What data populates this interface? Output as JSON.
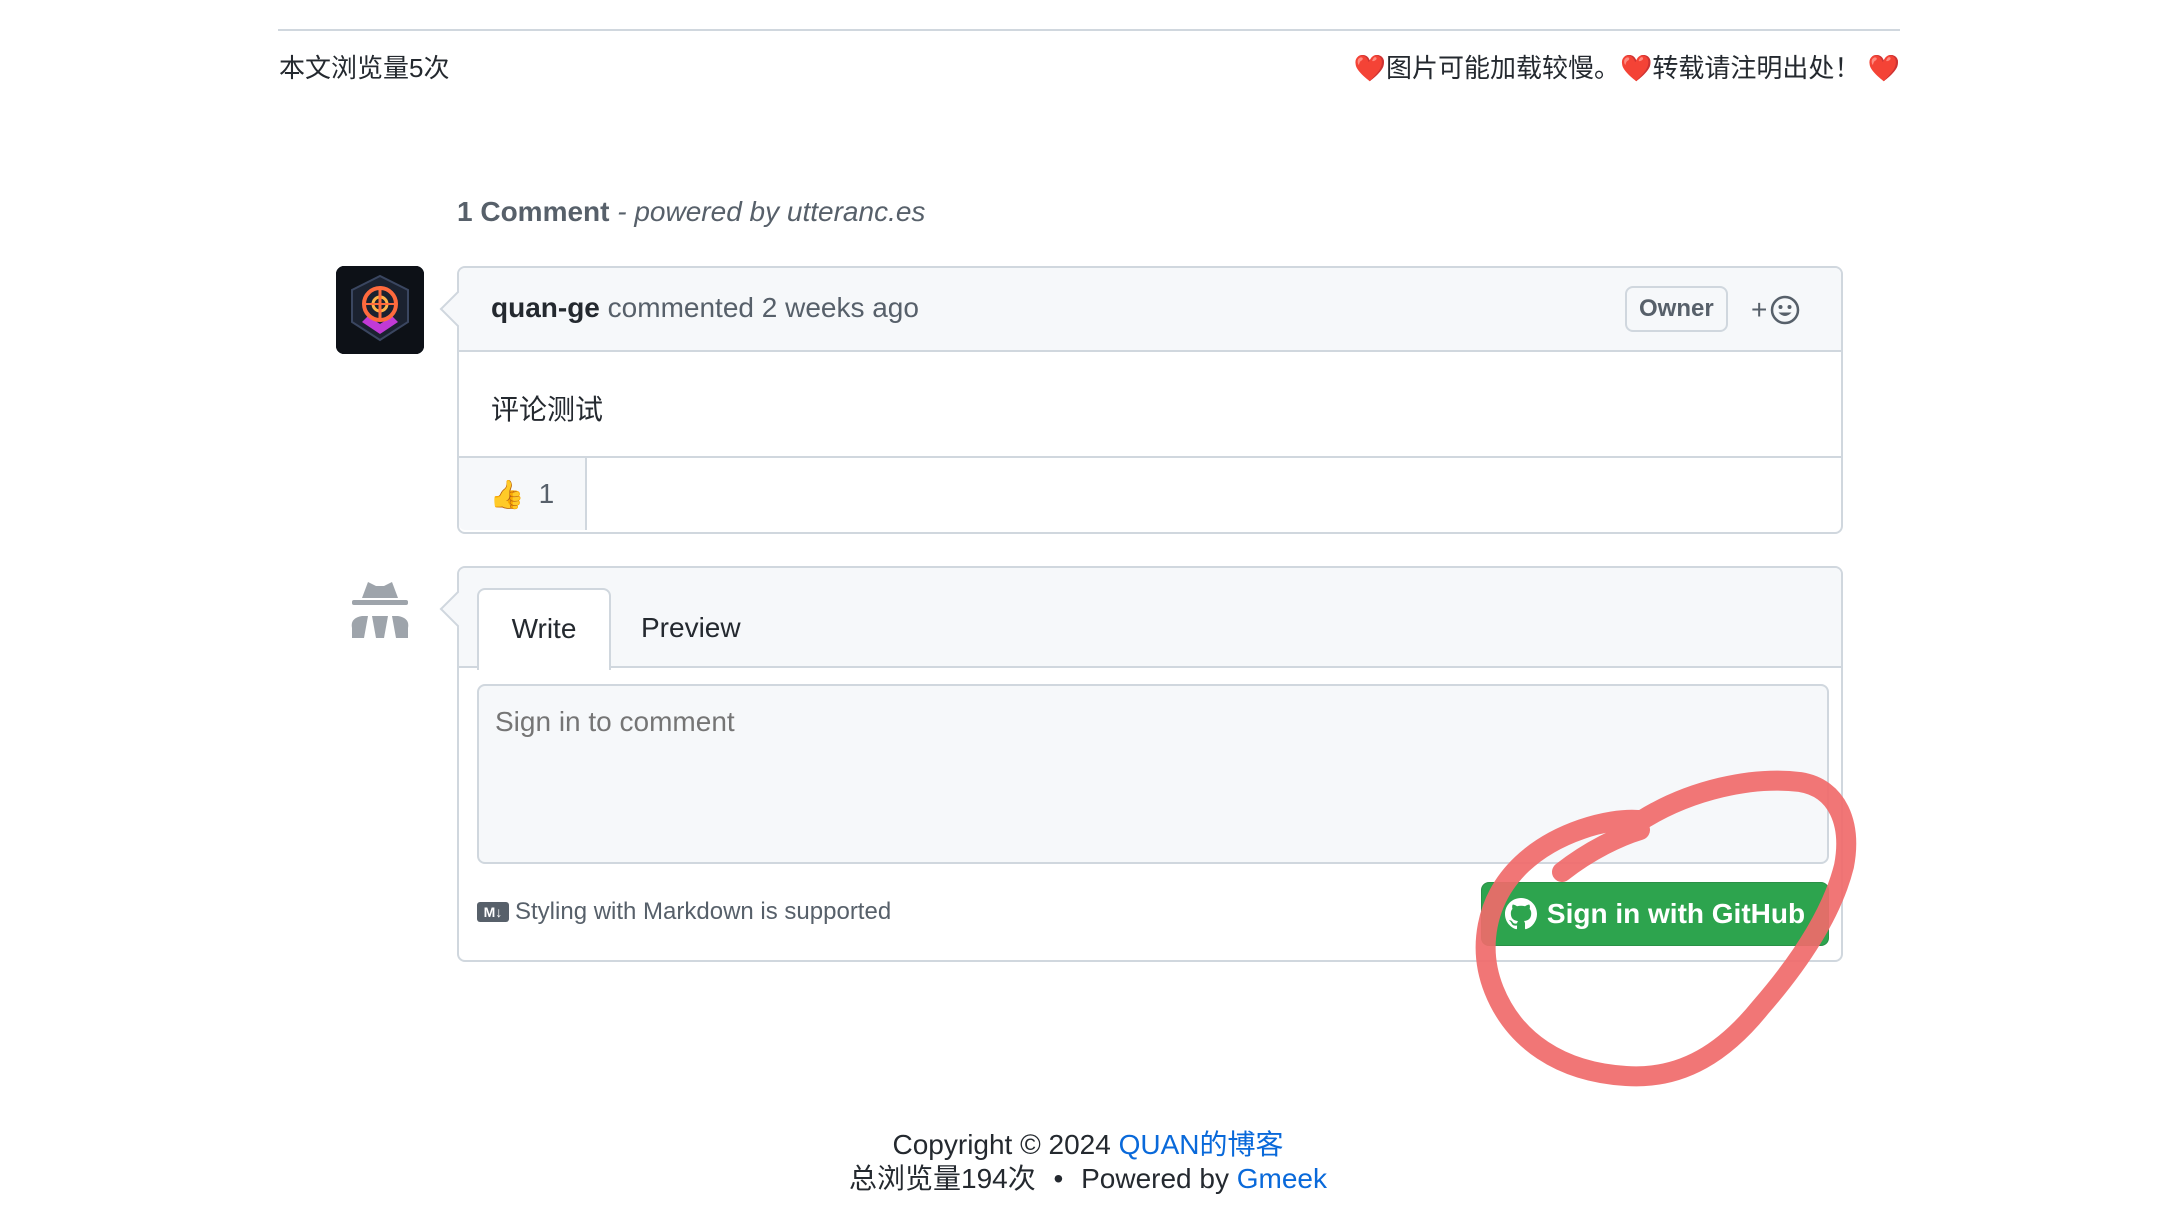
{
  "page": {
    "views_text": "本文浏览量5次",
    "notice": {
      "part1": "图片可能加载较慢。",
      "part2": "转载请注明出处！"
    }
  },
  "comments_section": {
    "count_label": "1 Comment",
    "powered_by": "- powered by utteranc.es",
    "comment": {
      "author": "quan-ge",
      "meta": "commented 2 weeks ago",
      "badge": "Owner",
      "add_reaction": "+",
      "body": "评论测试",
      "reaction_emoji": "👍",
      "reaction_count": "1"
    },
    "form": {
      "tab_write": "Write",
      "tab_preview": "Preview",
      "placeholder": "Sign in to comment",
      "md_icon": "M↓",
      "md_note": "Styling with Markdown is supported",
      "signin_button": "Sign in with GitHub"
    }
  },
  "footer": {
    "copyright": "Copyright © 2024",
    "blog_link": "QUAN的博客",
    "total_views": "总浏览量194次",
    "separator": "•",
    "powered_by": "Powered by",
    "gmeek_link": "Gmeek"
  },
  "colors": {
    "accent_link": "#0969da",
    "signin_green": "#2da44e",
    "annotation_red": "#f06a6a",
    "heart_red": "#e0202a"
  },
  "icons": [
    "heart-icon",
    "smiley-icon",
    "github-icon",
    "markdown-icon",
    "anonymous-avatar-icon"
  ]
}
